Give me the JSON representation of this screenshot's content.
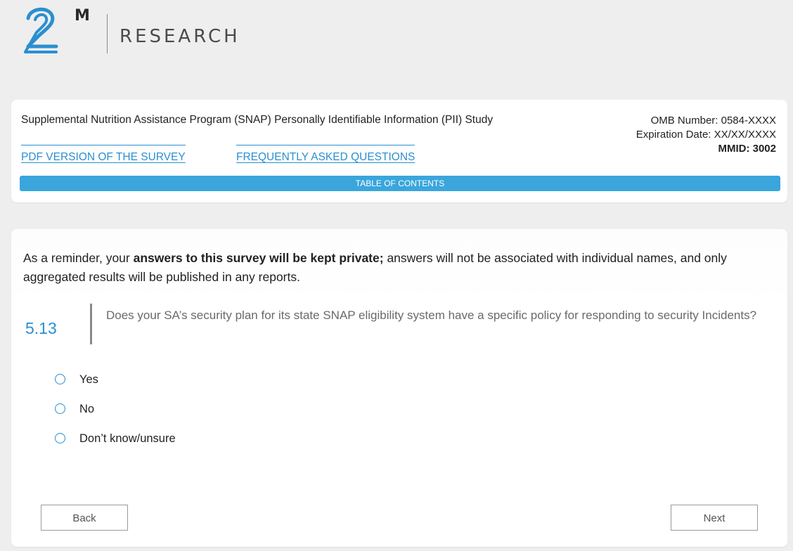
{
  "logo": {
    "superscript": "M",
    "wordmark": "RESEARCH"
  },
  "header": {
    "study_title": "Supplemental Nutrition Assistance Program (SNAP) Personally Identifiable Information (PII) Study",
    "omb_number": "OMB Number: 0584-XXXX",
    "expiration_date": "Expiration Date: XX/XX/XXXX",
    "mmid": "MMID: 3002",
    "links": {
      "pdf": "PDF VERSION OF THE SURVEY",
      "faq": "FREQUENTLY ASKED QUESTIONS"
    },
    "toc_label": "TABLE OF CONTENTS"
  },
  "main": {
    "reminder": {
      "before": "As a reminder, your ",
      "bold": "answers to this survey will be kept private;",
      "after": " answers will not be associated with individual names, and only aggregated results will be published in any reports."
    },
    "question": {
      "number": "5.13",
      "text": "Does your SA’s security plan for its state SNAP eligibility system have a specific policy for responding to security Incidents?"
    },
    "options": [
      {
        "label": "Yes",
        "selected": false
      },
      {
        "label": "No",
        "selected": false
      },
      {
        "label": "Don’t know/unsure",
        "selected": false
      }
    ],
    "buttons": {
      "back": "Back",
      "next": "Next"
    }
  },
  "colors": {
    "accent": "#2a8fd0",
    "toc_bar": "#3aa6dc",
    "page_background": "#eeeeee"
  }
}
